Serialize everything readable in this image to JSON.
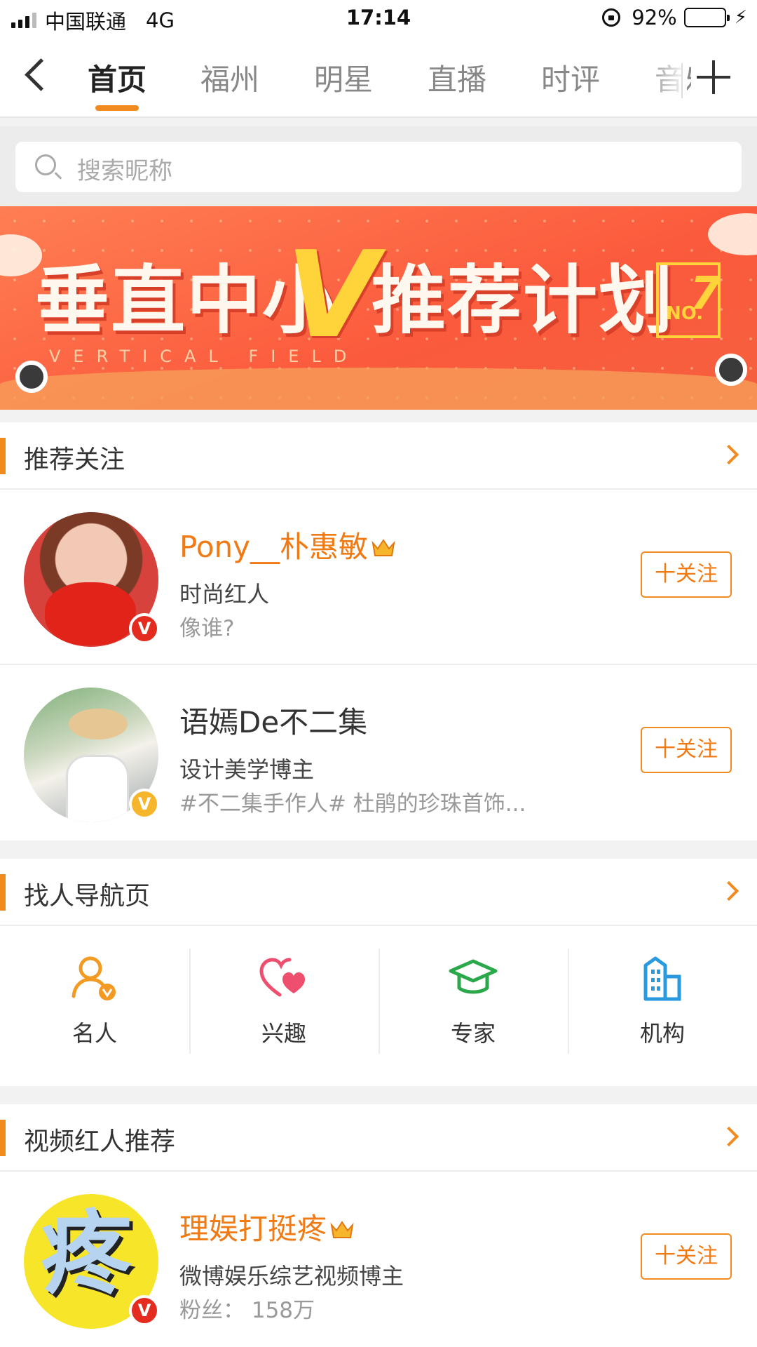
{
  "status_bar": {
    "carrier": "中国联通",
    "network": "4G",
    "time": "17:14",
    "battery_pct": "92%",
    "battery_level": 0.92,
    "colors": {
      "battery": "#3bd13b"
    }
  },
  "nav": {
    "tabs": [
      {
        "label": "首页",
        "active": true
      },
      {
        "label": "福州"
      },
      {
        "label": "明星"
      },
      {
        "label": "直播"
      },
      {
        "label": "时评"
      },
      {
        "label": "音乐"
      }
    ],
    "icons": {
      "back": "back-chevron-icon",
      "add": "plus-icon"
    }
  },
  "search": {
    "placeholder": "搜索昵称"
  },
  "banner": {
    "title_left": "垂直中小",
    "title_v": "V",
    "title_right": "推荐计划",
    "subtitle": "VERTICAL FIELD",
    "badge_no": "NO.",
    "badge_num": "7"
  },
  "recommended": {
    "title": "推荐关注",
    "users": [
      {
        "name": "Pony__朴惠敏",
        "tag": "时尚红人",
        "desc": "像谁?",
        "vip": true,
        "badge": "red",
        "follow": "十关注"
      },
      {
        "name": "语嫣De不二集",
        "tag": "设计美学博主",
        "desc": "#不二集手作人# 杜鹃的珍珠首饰...",
        "vip": false,
        "badge": "yellow",
        "follow": "十关注"
      }
    ]
  },
  "finder": {
    "title": "找人导航页",
    "items": [
      {
        "label": "名人",
        "icon": "celebrity-icon"
      },
      {
        "label": "兴趣",
        "icon": "interest-heart-icon"
      },
      {
        "label": "专家",
        "icon": "expert-cap-icon"
      },
      {
        "label": "机构",
        "icon": "organization-building-icon"
      }
    ]
  },
  "video_stars": {
    "title": "视频红人推荐",
    "users": [
      {
        "name": "理娱打挺疼",
        "tag": "微博娱乐综艺视频博主",
        "desc": "粉丝： 158万",
        "vip": true,
        "badge": "red",
        "follow": "十关注",
        "avatar_glyph": "疼"
      }
    ]
  },
  "colors": {
    "accent": "#f18a1f",
    "name_vip": "#f07a14",
    "verified_red": "#e42b1f",
    "verified_yellow": "#f7b52b"
  }
}
